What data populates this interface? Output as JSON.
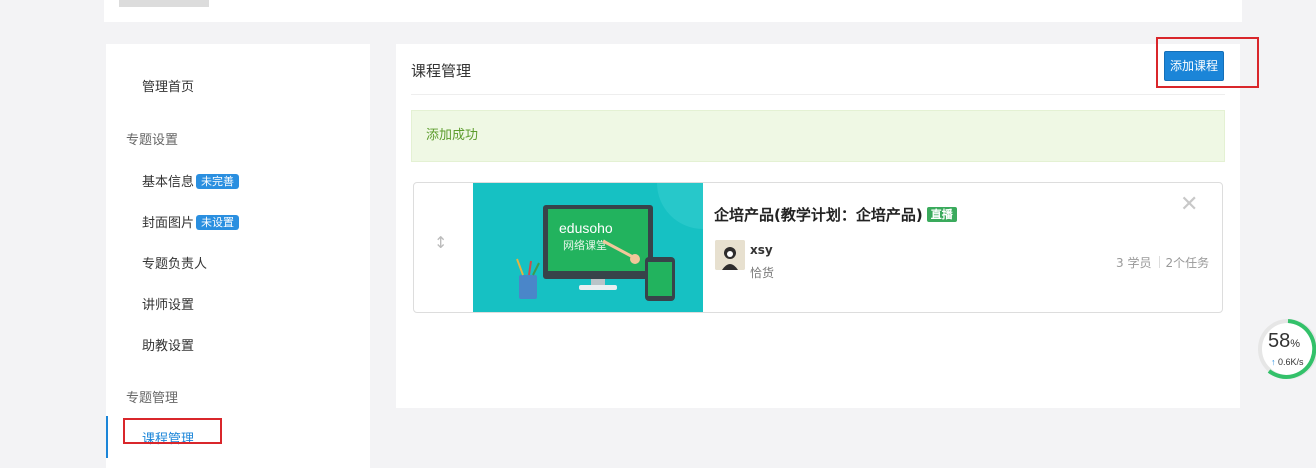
{
  "sidebar": {
    "items": [
      {
        "label": "管理首页"
      },
      {
        "group": "专题设置"
      },
      {
        "label": "基本信息",
        "badge": "未完善"
      },
      {
        "label": "封面图片",
        "badge": "未设置"
      },
      {
        "label": "专题负责人"
      },
      {
        "label": "讲师设置"
      },
      {
        "label": "助教设置"
      },
      {
        "group": "专题管理"
      },
      {
        "label": "课程管理",
        "active": true
      }
    ]
  },
  "main": {
    "title": "课程管理",
    "add_button": "添加课程",
    "alert": "添加成功",
    "course": {
      "title": "企培产品(教学计划：企培产品)",
      "badge": "直播",
      "cover": {
        "brand": "edusoho",
        "subtitle": "网络课堂"
      },
      "teacher_name": "xsy",
      "teacher_title": "恰货",
      "students": "3 学员",
      "tasks": "2个任务"
    }
  },
  "widget": {
    "percent": "58",
    "percent_unit": "%",
    "speed": "0.6K/s"
  },
  "colors": {
    "primary": "#1b85d8",
    "success_bg": "#eff8e4",
    "success_text": "#5c9c2c",
    "highlight": "#d9262b",
    "live": "#3aaa5c",
    "cover_bg": "#16c1c3"
  }
}
